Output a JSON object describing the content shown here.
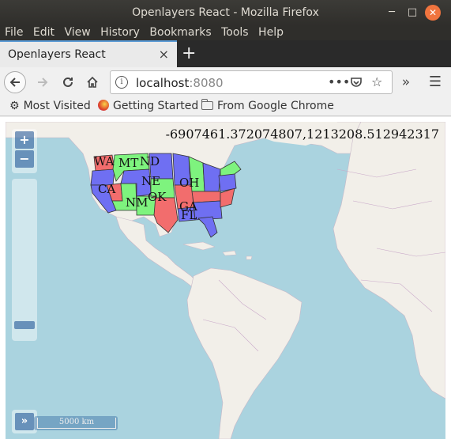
{
  "window": {
    "title": "Openlayers React - Mozilla Firefox"
  },
  "menu": [
    "File",
    "Edit",
    "View",
    "History",
    "Bookmarks",
    "Tools",
    "Help"
  ],
  "tab": {
    "label": "Openlayers React",
    "close": "×",
    "new_tab": "+"
  },
  "nav": {
    "url_host": "localhost",
    "url_port": ":8080",
    "info_glyph": "i"
  },
  "bookmarks": [
    {
      "label": "Most Visited",
      "icon": "gear-icon"
    },
    {
      "label": "Getting Started",
      "icon": "firefox-icon"
    },
    {
      "label": "From Google Chrome",
      "icon": "folder-icon"
    }
  ],
  "map": {
    "mouse_position": "-6907461.372074807,1213208.512942317",
    "zoom_in": "+",
    "zoom_out": "−",
    "overview_toggle": "»",
    "scale_label": "5000 km",
    "state_labels": [
      "WA",
      "MT",
      "ND",
      "NE",
      "CA",
      "NM",
      "OK",
      "OH",
      "GA",
      "FL"
    ],
    "state_colors": {
      "red": "#f26d6d",
      "green": "#7ef37e",
      "blue": "#6f6ff2"
    },
    "ocean_color": "#aad3df",
    "land_color": "#f2efe9"
  }
}
